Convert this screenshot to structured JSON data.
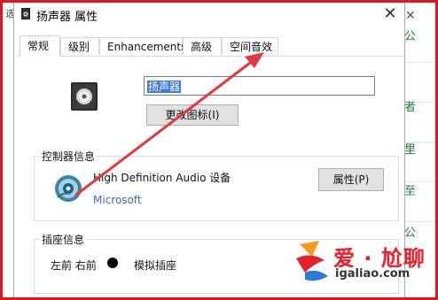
{
  "window": {
    "title": "扬声器 属性",
    "close_glyph": "✕"
  },
  "tabs": [
    {
      "label": "常规",
      "active": true
    },
    {
      "label": "级别",
      "active": false
    },
    {
      "label": "Enhancements",
      "active": false
    },
    {
      "label": "高级",
      "active": false
    },
    {
      "label": "空间音效",
      "active": false
    }
  ],
  "general": {
    "device_name_value": "扬声器",
    "change_icon_label": "更改图标(I)"
  },
  "controller": {
    "group_label": "控制器信息",
    "device_name": "High Definition Audio 设备",
    "vendor": "Microsoft",
    "properties_label": "属性(P)"
  },
  "jack": {
    "group_label": "插座信息",
    "position": "左前 右前",
    "type": "模拟插座"
  },
  "background": {
    "left_text": "选",
    "right_items": [
      "公",
      "者",
      "里",
      "至",
      "公"
    ]
  },
  "watermark": {
    "title": "爱 · 尬聊",
    "url": "igaliao.com"
  },
  "colors": {
    "frame": "#e0161d",
    "arrow": "#e03a3e",
    "selection": "#3b78d8",
    "link": "#3f6aa8"
  }
}
